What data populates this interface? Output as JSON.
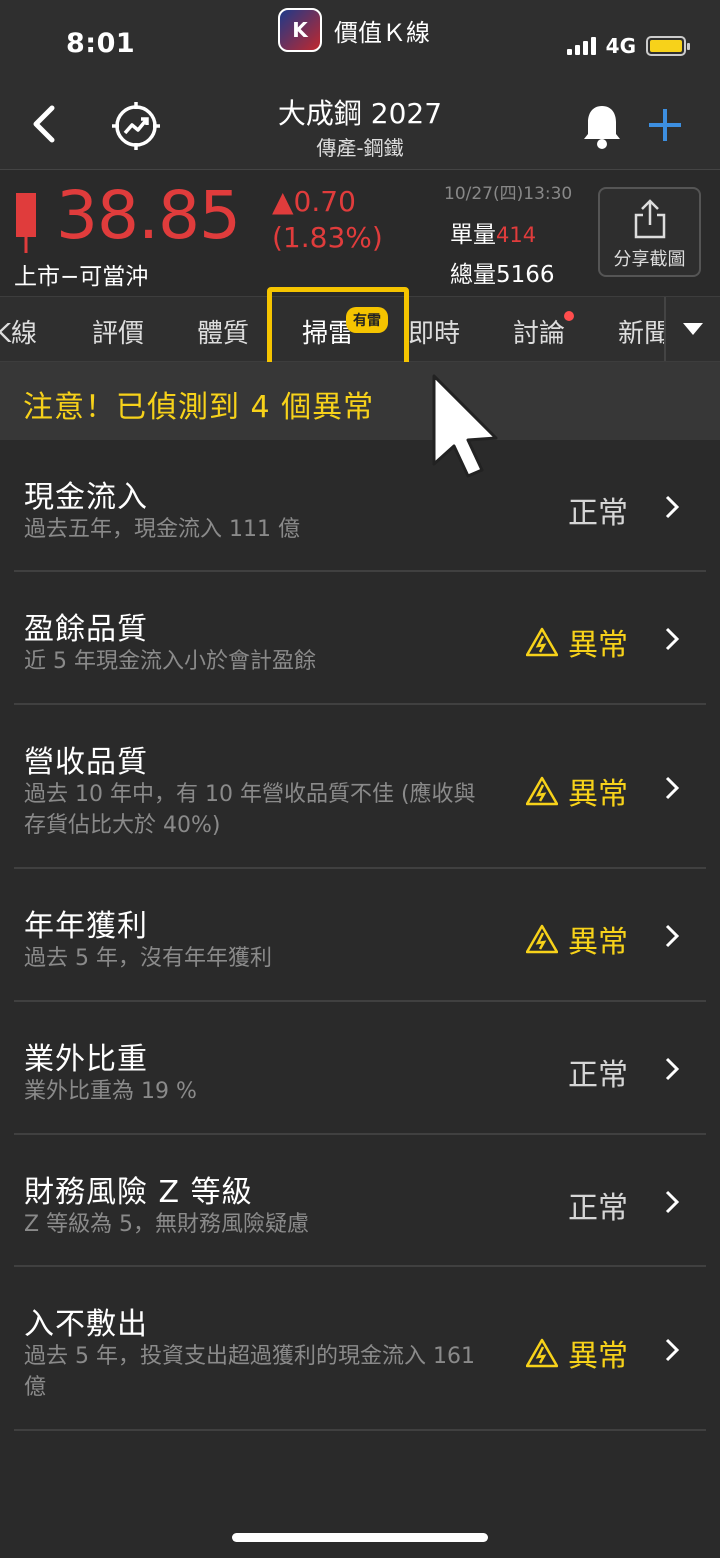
{
  "status_bar": {
    "time": "8:01",
    "app_name": "價值Ｋ線",
    "app_icon_letter": "K",
    "network": "4G",
    "battery_color": "#f7d21a"
  },
  "header": {
    "title": "大成鋼 2027",
    "subtitle": "傳產-鋼鐵"
  },
  "quote": {
    "price": "38.85",
    "change": "▲0.70",
    "change_pct": "(1.83%)",
    "market": "上市−可當沖",
    "time": "10/27(四)13:30",
    "volume_label": "單量",
    "volume_value": "414",
    "total_label": "總量",
    "total_value": "5166",
    "share_label": "分享截圖",
    "up_color": "#e03c3c"
  },
  "tabs": [
    {
      "label": "K線"
    },
    {
      "label": "評價"
    },
    {
      "label": "體質"
    },
    {
      "label": "掃雷",
      "badge": "有雷"
    },
    {
      "label": "即時"
    },
    {
      "label": "討論"
    },
    {
      "label": "新聞"
    }
  ],
  "alert": {
    "text": "注意！已偵測到 4 個異常"
  },
  "items": [
    {
      "title": "現金流入",
      "desc": "過去五年，現金流入 111 億",
      "status": "正常",
      "abnormal": false
    },
    {
      "title": "盈餘品質",
      "desc": "近 5 年現金流入小於會計盈餘",
      "status": "異常",
      "abnormal": true
    },
    {
      "title": "營收品質",
      "desc": "過去 10 年中，有 10 年營收品質不佳 (應收與存貨佔比大於 40%)",
      "status": "異常",
      "abnormal": true
    },
    {
      "title": "年年獲利",
      "desc": "過去 5 年，沒有年年獲利",
      "status": "異常",
      "abnormal": true
    },
    {
      "title": "業外比重",
      "desc": "業外比重為 19 %",
      "status": "正常",
      "abnormal": false
    },
    {
      "title": "財務風險 Z 等級",
      "desc": "Z 等級為 5，無財務風險疑慮",
      "status": "正常",
      "abnormal": false
    },
    {
      "title": "入不敷出",
      "desc": "過去 5 年，投資支出超過獲利的現金流入 161 億",
      "status": "異常",
      "abnormal": true
    }
  ]
}
